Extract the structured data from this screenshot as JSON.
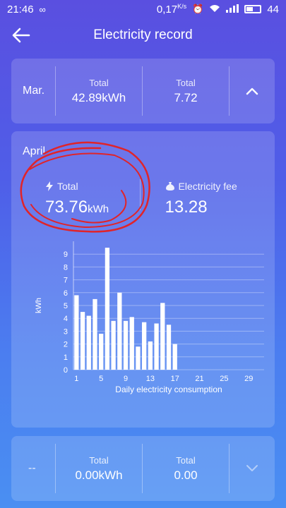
{
  "status_bar": {
    "time": "21:46",
    "net_speed": "0,17",
    "net_unit": "K/s",
    "battery": "44"
  },
  "header": {
    "title": "Electricity record"
  },
  "top_card": {
    "month": "Mar.",
    "total_energy_label": "Total",
    "total_energy_value": "42.89kWh",
    "total_fee_label": "Total",
    "total_fee_value": "7.72"
  },
  "detail_card": {
    "month": "April",
    "total_label": "Total",
    "total_value": "73.76",
    "total_unit": "kWh",
    "fee_label": "Electricity fee",
    "fee_value": "13.28"
  },
  "chart_data": {
    "type": "bar",
    "ylabel": "kWh",
    "xlabel": "Daily electricity consumption",
    "x_ticks": [
      "1",
      "5",
      "9",
      "13",
      "17",
      "21",
      "25",
      "29"
    ],
    "y_ticks": [
      "0",
      "1",
      "2",
      "3",
      "4",
      "5",
      "6",
      "7",
      "8",
      "9"
    ],
    "ylim": [
      0,
      10
    ],
    "categories": [
      "1",
      "2",
      "3",
      "4",
      "5",
      "6",
      "7",
      "8",
      "9",
      "10",
      "11",
      "12",
      "13",
      "14",
      "15",
      "16",
      "17"
    ],
    "values": [
      5.8,
      4.5,
      4.2,
      5.5,
      2.8,
      9.5,
      3.8,
      6.0,
      3.8,
      4.1,
      1.8,
      3.7,
      2.2,
      3.6,
      5.2,
      3.5,
      2.0
    ]
  },
  "bottom_card": {
    "month": "--",
    "total_energy_label": "Total",
    "total_energy_value": "0.00kWh",
    "total_fee_label": "Total",
    "total_fee_value": "0.00"
  }
}
